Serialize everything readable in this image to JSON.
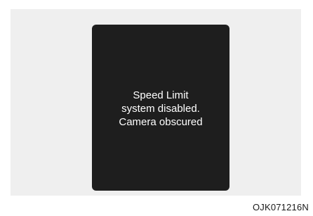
{
  "display": {
    "message_lines": [
      "Speed Limit",
      "system disabled.",
      "Camera obscured"
    ]
  },
  "figure": {
    "code": "OJK071216N"
  }
}
